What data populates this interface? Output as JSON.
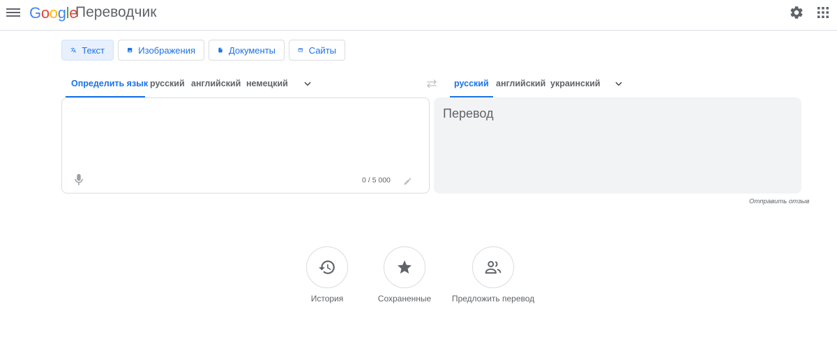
{
  "header": {
    "logo": [
      "G",
      "o",
      "o",
      "g",
      "l",
      "e"
    ],
    "app_name": "Переводчик"
  },
  "modes": [
    {
      "label": "Текст",
      "icon": "translate-icon",
      "active": true
    },
    {
      "label": "Изображения",
      "icon": "image-icon",
      "active": false
    },
    {
      "label": "Документы",
      "icon": "document-icon",
      "active": false
    },
    {
      "label": "Сайты",
      "icon": "website-icon",
      "active": false
    }
  ],
  "source_langs": [
    "Определить язык",
    "русский",
    "английский",
    "немецкий"
  ],
  "target_langs": [
    "русский",
    "английский",
    "украинский"
  ],
  "source": {
    "value": "",
    "counter": "0 / 5 000"
  },
  "target": {
    "placeholder": "Перевод"
  },
  "feedback_link": "Отправить отзыв",
  "bottom": [
    {
      "label": "История",
      "icon": "history-icon"
    },
    {
      "label": "Сохраненные",
      "icon": "star-icon"
    },
    {
      "label": "Предложить перевод",
      "icon": "people-icon"
    }
  ],
  "colors": {
    "accent": "#1a73e8",
    "active_mode_bg": "#e8f0fe",
    "target_panel_bg": "#f1f3f4"
  }
}
